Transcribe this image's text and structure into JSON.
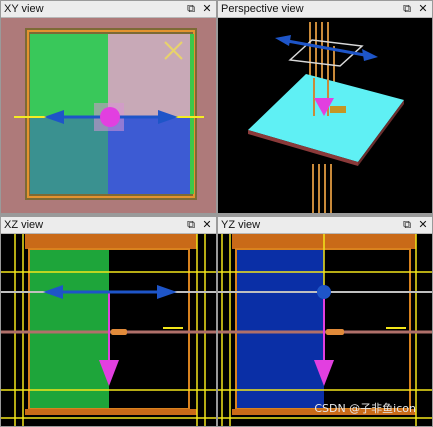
{
  "viewports": {
    "xy": {
      "title": "XY view"
    },
    "perspective": {
      "title": "Perspective view"
    },
    "xz": {
      "title": "XZ view"
    },
    "yz": {
      "title": "YZ view"
    }
  },
  "window_buttons": {
    "restore": "⧉",
    "close": "✕"
  },
  "icons": {
    "restore": "restore-icon",
    "close": "close-icon"
  },
  "colors": {
    "xy_background": "#ae7a7a",
    "gizmo_axis": "#1e55c8",
    "gizmo_center": "#e23fe0",
    "selection_yellow": "#f2e61a",
    "plane_cyan": "#5ff0f4"
  },
  "watermark": "CSDN @子非鱼icon"
}
